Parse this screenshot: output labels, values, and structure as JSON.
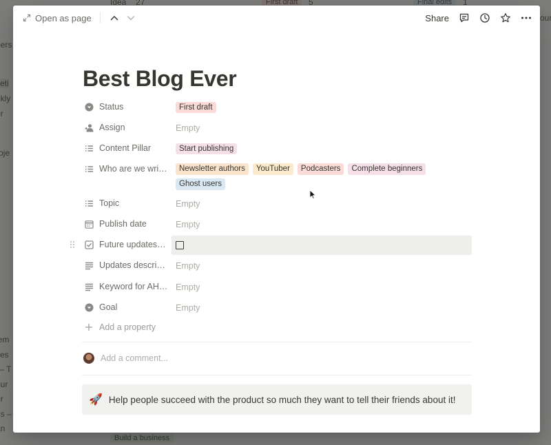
{
  "background": {
    "fragments": [
      "Idea",
      "27",
      "First draft",
      "5",
      "Final edits",
      "1",
      "bers",
      "keti",
      "ekly",
      "er",
      "roje",
      "lem",
      "ites",
      "— T",
      "our",
      "er",
      "ds –",
      "an",
      "our"
    ],
    "bottom_tag": "Build a business"
  },
  "topbar": {
    "open_as_page": "Open as page",
    "share": "Share"
  },
  "page": {
    "title": "Best Blog Ever"
  },
  "properties": {
    "status": {
      "label": "Status",
      "tags": [
        "First draft"
      ]
    },
    "assign": {
      "label": "Assign",
      "value": "Empty"
    },
    "content_pillar": {
      "label": "Content Pillar",
      "tags": [
        "Start publishing"
      ]
    },
    "audience": {
      "label": "Who are we writi...",
      "tags": [
        "Newsletter authors",
        "YouTuber",
        "Podcasters",
        "Complete beginners",
        "Ghost users"
      ]
    },
    "topic": {
      "label": "Topic",
      "value": "Empty"
    },
    "publish_date": {
      "label": "Publish date",
      "value": "Empty"
    },
    "future_updates": {
      "label": "Future updates r...",
      "checked": false
    },
    "updates_desc": {
      "label": "Updates descript...",
      "value": "Empty"
    },
    "keyword": {
      "label": "Keyword for AHR...",
      "value": "Empty"
    },
    "goal": {
      "label": "Goal",
      "value": "Empty"
    }
  },
  "add_property": "Add a property",
  "comment": {
    "placeholder": "Add a comment..."
  },
  "callout": {
    "icon": "🚀",
    "text": "Help people succeed with the product so much they want to tell their friends about it!"
  },
  "colors": {
    "tag_red": "#fadbd7",
    "tag_pink": "#f5dfe9",
    "tag_orange": "#fbe4cd",
    "tag_yellow": "#fbeacb",
    "tag_blue": "#d9e8f3",
    "tag_green": "#dbeddb"
  }
}
